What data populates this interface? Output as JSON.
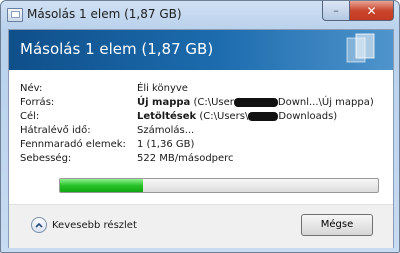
{
  "window": {
    "title": "Másolás 1 elem (1,87 GB)",
    "minimize_glyph": "–",
    "close_glyph": "✕"
  },
  "header": {
    "title": "Másolás 1 elem (1,87 GB)"
  },
  "details": {
    "name": {
      "label": "Név:",
      "value": "Éli könyve"
    },
    "source": {
      "label": "Forrás:",
      "bold": "Új mappa",
      "pre": "(C:\\User",
      "post": "Downl...\\Új mappa)"
    },
    "target": {
      "label": "Cél:",
      "bold": "Letöltések",
      "pre": "(C:\\Users\\",
      "post": "Downloads)"
    },
    "time_left": {
      "label": "Hátralévő idő:",
      "value": "Számolás..."
    },
    "items_left": {
      "label": "Fennmaradó elemek:",
      "value": "1 (1,36 GB)"
    },
    "speed": {
      "label": "Sebesség:",
      "value": "522 MB/másodperc"
    }
  },
  "progress": {
    "fraction": 0.26,
    "color": "#22bb22"
  },
  "footer": {
    "more_label": "Kevesebb részlet",
    "cancel_label": "Mégse"
  },
  "colors": {
    "header_start": "#0f4f8a",
    "header_end": "#4f94cc"
  }
}
